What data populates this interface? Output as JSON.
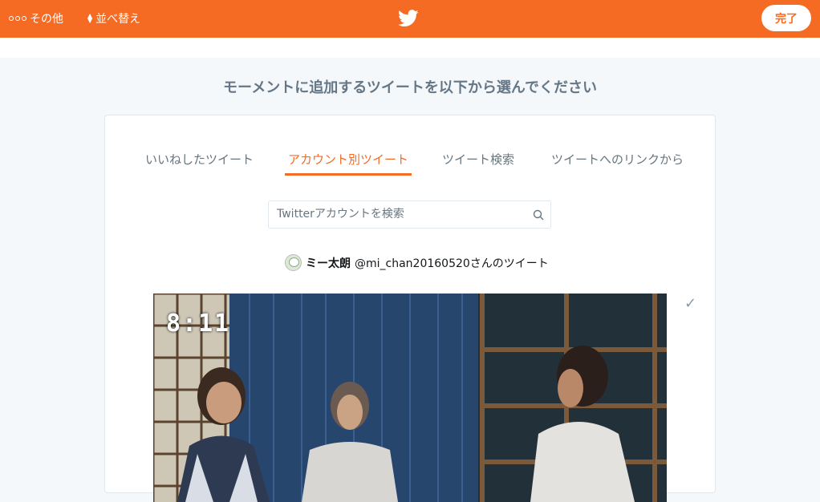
{
  "topbar": {
    "more_label": "その他",
    "sort_label": "並べ替え",
    "done_label": "完了",
    "logo_icon": "twitter-bird-icon",
    "background_color": "#f56b24"
  },
  "heading": "モーメントに追加するツイートを以下から選んでください",
  "tabs": [
    {
      "label": "いいねしたツイート"
    },
    {
      "label": "アカウント別ツイート"
    },
    {
      "label": "ツイート検索"
    },
    {
      "label": "ツイートへのリンクから"
    }
  ],
  "active_tab": "アカウント別ツイート",
  "search": {
    "placeholder": "Twitterアカウントを検索"
  },
  "account": {
    "display_name": "ミー太朗",
    "handle_suffix": "@mi_chan20160520さんのツイート"
  },
  "tweet": {
    "media_timestamp": "8:11",
    "selected_icon": "checkmark-icon"
  }
}
